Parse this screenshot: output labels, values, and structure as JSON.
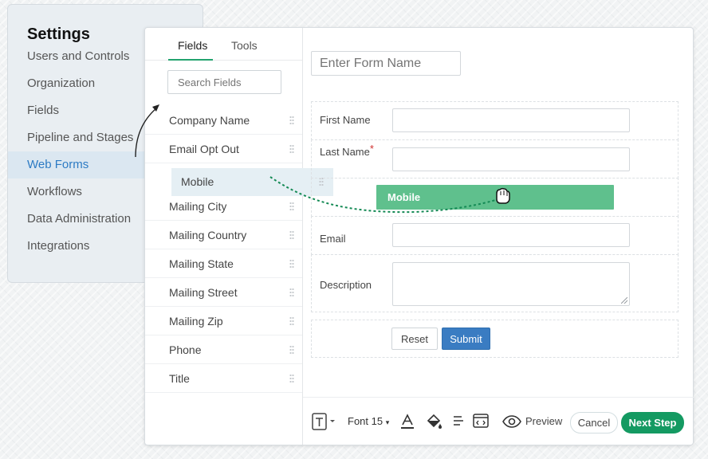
{
  "settings": {
    "title": "Settings",
    "nav": [
      {
        "label": "Users and Controls"
      },
      {
        "label": "Organization"
      },
      {
        "label": "Fields"
      },
      {
        "label": "Pipeline and Stages"
      },
      {
        "label": "Web Forms",
        "active": true
      },
      {
        "label": "Workflows"
      },
      {
        "label": "Data Administration"
      },
      {
        "label": "Integrations"
      }
    ]
  },
  "panel": {
    "tabs": [
      {
        "label": "Fields",
        "active": true
      },
      {
        "label": "Tools"
      }
    ],
    "search_placeholder": "Search Fields",
    "fields": [
      "Company Name",
      "Email Opt Out",
      "",
      "Mailing City",
      "Mailing Country",
      "Mailing State",
      "Mailing Street",
      "Mailing Zip",
      "Phone",
      "Title"
    ],
    "dragging_field": "Mobile"
  },
  "form": {
    "name_placeholder": "Enter Form Name",
    "rows": {
      "first_name": "First Name",
      "last_name": "Last Name",
      "required_mark": "*",
      "email": "Email",
      "description": "Description"
    },
    "drop_label": "Mobile",
    "reset_label": "Reset",
    "submit_label": "Submit"
  },
  "toolbar": {
    "font_label": "Font 15",
    "preview_label": "Preview",
    "cancel_label": "Cancel",
    "next_label": "Next Step"
  },
  "colors": {
    "accent_green": "#149a62",
    "drop_green": "#5fc08d",
    "link_blue": "#2d7bc4",
    "submit_blue": "#3a7cc2"
  },
  "icons": [
    "text-format-icon",
    "font-color-icon",
    "fill-color-icon",
    "align-icon",
    "embed-code-icon",
    "eye-icon",
    "drag-hand-icon",
    "grip-icon"
  ]
}
